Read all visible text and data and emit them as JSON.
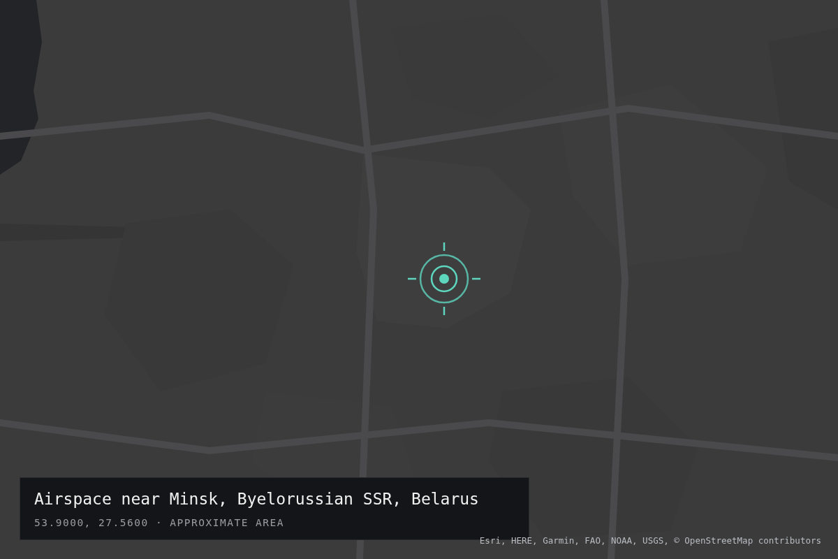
{
  "location_card": {
    "title": "Airspace near Minsk, Byelorussian SSR, Belarus",
    "subtitle": "53.9000, 27.5600 · APPROXIMATE AREA"
  },
  "attribution": "Esri, HERE, Garmin, FAO, NOAA, USGS, © OpenStreetMap contributors"
}
